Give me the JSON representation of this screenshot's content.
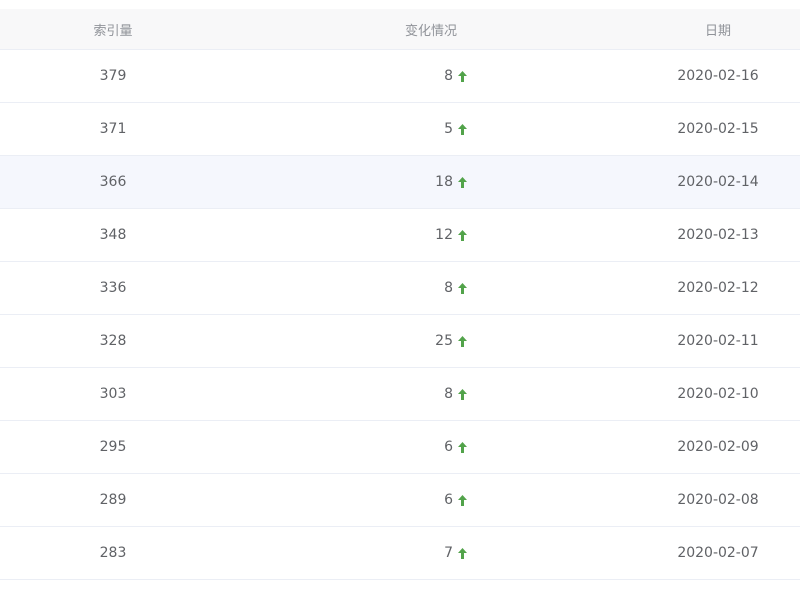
{
  "columns": {
    "index": "索引量",
    "change": "变化情况",
    "date": "日期"
  },
  "colors": {
    "up_arrow": "#52a34a",
    "header_bg": "#f8f8f9",
    "row_highlight": "#f5f7fd"
  },
  "rows": [
    {
      "index": "379",
      "change": "8",
      "trend": "up",
      "date": "2020-02-16"
    },
    {
      "index": "371",
      "change": "5",
      "trend": "up",
      "date": "2020-02-15"
    },
    {
      "index": "366",
      "change": "18",
      "trend": "up",
      "date": "2020-02-14"
    },
    {
      "index": "348",
      "change": "12",
      "trend": "up",
      "date": "2020-02-13"
    },
    {
      "index": "336",
      "change": "8",
      "trend": "up",
      "date": "2020-02-12"
    },
    {
      "index": "328",
      "change": "25",
      "trend": "up",
      "date": "2020-02-11"
    },
    {
      "index": "303",
      "change": "8",
      "trend": "up",
      "date": "2020-02-10"
    },
    {
      "index": "295",
      "change": "6",
      "trend": "up",
      "date": "2020-02-09"
    },
    {
      "index": "289",
      "change": "6",
      "trend": "up",
      "date": "2020-02-08"
    },
    {
      "index": "283",
      "change": "7",
      "trend": "up",
      "date": "2020-02-07"
    }
  ]
}
